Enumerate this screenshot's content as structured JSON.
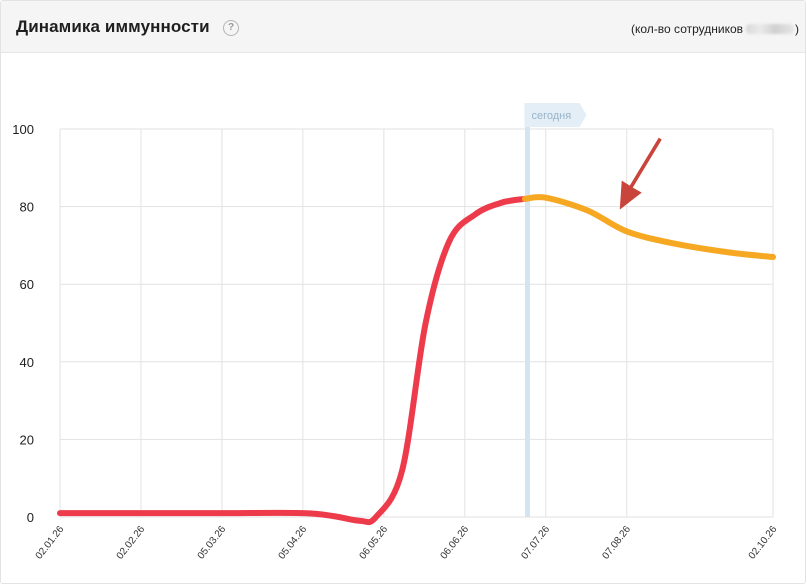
{
  "header": {
    "title": "Динамика иммунности",
    "help_icon": "?",
    "count_prefix": "(кол-во сотрудников",
    "count_suffix": ")"
  },
  "chart_data": {
    "type": "line",
    "title": "Динамика иммунности",
    "xlabel": "",
    "ylabel": "",
    "ylim": [
      0,
      100
    ],
    "yticks": [
      0,
      20,
      40,
      60,
      80,
      100
    ],
    "xticks": [
      "02.01.26",
      "02.02.26",
      "05.03.26",
      "05.04.26",
      "06.05.26",
      "06.06.26",
      "07.07.26",
      "07.08.26",
      "02.10.26"
    ],
    "grid": true,
    "today_marker": {
      "label": "сегодня",
      "date": "2026-06-30"
    },
    "series": [
      {
        "color": "#ee3b4b",
        "points": [
          {
            "x": "2026-01-02",
            "y": 1
          },
          {
            "x": "2026-02-02",
            "y": 1
          },
          {
            "x": "2026-03-05",
            "y": 1
          },
          {
            "x": "2026-04-05",
            "y": 1
          },
          {
            "x": "2026-04-17",
            "y": 0.2
          },
          {
            "x": "2026-04-27",
            "y": -1
          },
          {
            "x": "2026-05-03",
            "y": 0
          },
          {
            "x": "2026-05-13",
            "y": 12
          },
          {
            "x": "2026-05-22",
            "y": 50
          },
          {
            "x": "2026-05-31",
            "y": 71
          },
          {
            "x": "2026-06-10",
            "y": 78
          },
          {
            "x": "2026-06-20",
            "y": 81
          },
          {
            "x": "2026-06-29",
            "y": 82
          }
        ]
      },
      {
        "color": "#f7a823",
        "points": [
          {
            "x": "2026-06-29",
            "y": 82
          },
          {
            "x": "2026-07-07",
            "y": 82.3
          },
          {
            "x": "2026-07-23",
            "y": 79
          },
          {
            "x": "2026-08-07",
            "y": 73.6
          },
          {
            "x": "2026-08-25",
            "y": 70.5
          },
          {
            "x": "2026-09-15",
            "y": 68.2
          },
          {
            "x": "2026-10-02",
            "y": 67
          }
        ]
      }
    ],
    "annotation_arrow": {
      "color": "#c9443a",
      "points_to": "2026-08-07"
    }
  }
}
